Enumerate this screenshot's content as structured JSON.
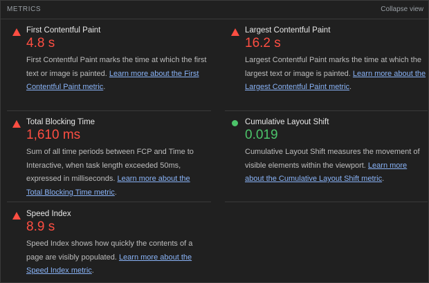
{
  "header": {
    "title": "METRICS",
    "collapse_label": "Collapse view"
  },
  "metrics": {
    "fcp": {
      "name": "First Contentful Paint",
      "value": "4.8 s",
      "status": "poor",
      "description": "First Contentful Paint marks the time at which the first text or image is painted. ",
      "link_text": "Learn more about the First Contentful Paint metric",
      "suffix": "."
    },
    "lcp": {
      "name": "Largest Contentful Paint",
      "value": "16.2 s",
      "status": "poor",
      "description": "Largest Contentful Paint marks the time at which the largest text or image is painted. ",
      "link_text": "Learn more about the Largest Contentful Paint metric",
      "suffix": "."
    },
    "tbt": {
      "name": "Total Blocking Time",
      "value": "1,610 ms",
      "status": "poor",
      "description": "Sum of all time periods between FCP and Time to Interactive, when task length exceeded 50ms, expressed in milliseconds. ",
      "link_text": "Learn more about the Total Blocking Time metric",
      "suffix": "."
    },
    "cls": {
      "name": "Cumulative Layout Shift",
      "value": "0.019",
      "status": "good",
      "description": "Cumulative Layout Shift measures the movement of visible elements within the viewport. ",
      "link_text": "Learn more about the Cumulative Layout Shift metric",
      "suffix": "."
    },
    "si": {
      "name": "Speed Index",
      "value": "8.9 s",
      "status": "poor",
      "description": "Speed Index shows how quickly the contents of a page are visibly populated. ",
      "link_text": "Learn more about the Speed Index metric",
      "suffix": "."
    }
  },
  "colors": {
    "poor": "#ff4e42",
    "good": "#4cc46a",
    "link": "#8ab4f8"
  },
  "icons": {
    "poor": "red-triangle-icon",
    "good": "green-circle-icon"
  }
}
